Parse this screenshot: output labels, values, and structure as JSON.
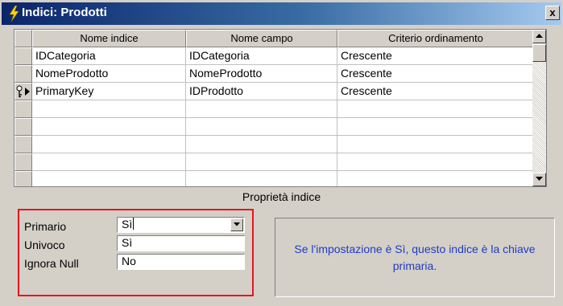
{
  "window": {
    "title": "Indici: Prodotti",
    "close_label": "x",
    "title_gradient": [
      "#0a246a",
      "#a6caf0"
    ]
  },
  "grid": {
    "columns": [
      "Nome indice",
      "Nome campo",
      "Criterio ordinamento"
    ],
    "rows": [
      {
        "index_name": "IDCategoria",
        "field_name": "IDCategoria",
        "sort_order": "Crescente"
      },
      {
        "index_name": "NomeProdotto",
        "field_name": "NomeProdotto",
        "sort_order": "Crescente"
      },
      {
        "index_name": "PrimaryKey",
        "field_name": "IDProdotto",
        "sort_order": "Crescente",
        "primary_key": true,
        "current": true
      }
    ],
    "empty_row_count": 4
  },
  "properties": {
    "section_title": "Proprietà indice",
    "primario_label": "Primario",
    "primario_value": "Sì",
    "univoco_label": "Univoco",
    "univoco_value": "Sì",
    "ignora_null_label": "Ignora Null",
    "ignora_null_value": "No",
    "highlight_color": "#e8141e"
  },
  "help": {
    "text": "Se l'impostazione è Sì, questo indice è la chiave primaria.",
    "text_color": "#1f3cc4"
  },
  "icons": {
    "title": "lightning-bolt-icon",
    "primary_key": "key-icon",
    "current_row": "row-pointer-icon",
    "scroll_up": "scroll-up-arrow-icon",
    "scroll_down": "scroll-down-arrow-icon",
    "dropdown": "dropdown-arrow-icon"
  }
}
